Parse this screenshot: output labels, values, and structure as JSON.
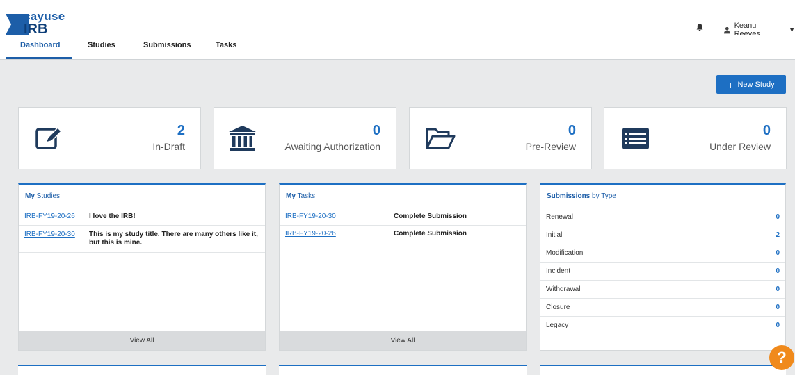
{
  "header": {
    "logo_top": "cayuse",
    "logo_bottom": "IRB",
    "user_name": "Keanu Reeves",
    "icons": [
      "bell-icon",
      "user-icon",
      "caret-down-icon"
    ]
  },
  "nav": {
    "tabs": [
      {
        "label": "Dashboard",
        "active": true
      },
      {
        "label": "Studies"
      },
      {
        "label": "Submissions"
      },
      {
        "label": "Tasks"
      }
    ]
  },
  "actions": {
    "new_study": "New Study"
  },
  "stats": [
    {
      "count": "2",
      "label": "In-Draft",
      "icon": "edit-icon"
    },
    {
      "count": "0",
      "label": "Awaiting Authorization",
      "icon": "bank-icon"
    },
    {
      "count": "0",
      "label": "Pre-Review",
      "icon": "folder-open-icon"
    },
    {
      "count": "0",
      "label": "Under Review",
      "icon": "list-icon"
    }
  ],
  "my_studies": {
    "title_bold": "My",
    "title_rest": " Studies",
    "rows": [
      {
        "id": "IRB-FY19-20-26",
        "title": "I love the IRB!"
      },
      {
        "id": "IRB-FY19-20-30",
        "title": "This is my study title. There are many others like it, but this is mine."
      }
    ],
    "view_all": "View All"
  },
  "my_tasks": {
    "title_bold": "My",
    "title_rest": " Tasks",
    "rows": [
      {
        "id": "IRB-FY19-20-30",
        "task": "Complete Submission"
      },
      {
        "id": "IRB-FY19-20-26",
        "task": "Complete Submission"
      }
    ],
    "view_all": "View All"
  },
  "submissions_by_type": {
    "title_bold": "Submissions",
    "title_rest": " by Type",
    "rows": [
      {
        "type": "Renewal",
        "count": "0"
      },
      {
        "type": "Initial",
        "count": "2"
      },
      {
        "type": "Modification",
        "count": "0"
      },
      {
        "type": "Incident",
        "count": "0"
      },
      {
        "type": "Withdrawal",
        "count": "0"
      },
      {
        "type": "Closure",
        "count": "0"
      },
      {
        "type": "Legacy",
        "count": "0"
      }
    ]
  },
  "help": "?",
  "colors": {
    "accent": "#1d6fc3",
    "brand": "#1d5ea8",
    "help": "#f08a1c"
  }
}
